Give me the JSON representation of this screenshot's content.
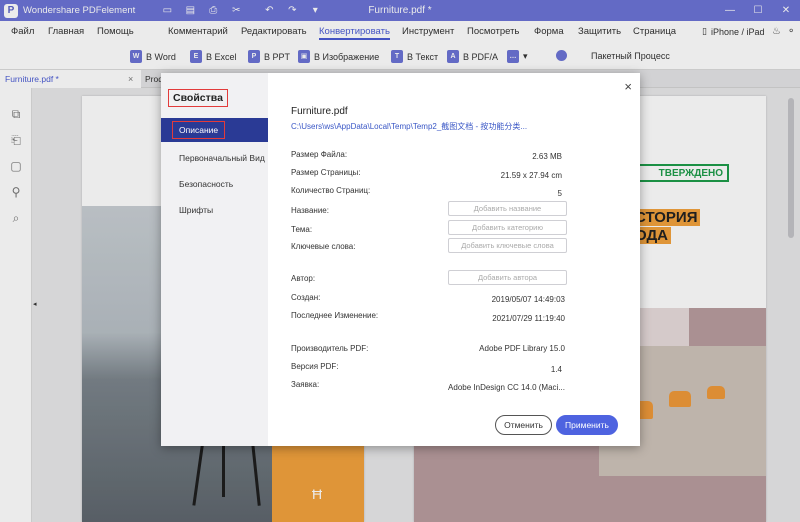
{
  "app": {
    "name": "Wondershare PDFelement",
    "document_title": "Furniture.pdf *",
    "logo_letter": "P"
  },
  "quick_access": [
    "folder-icon",
    "save-icon",
    "print-icon",
    "share-icon",
    "undo-icon",
    "redo-icon",
    "dropdown-icon"
  ],
  "window_controls": [
    "minimize-icon",
    "maximize-icon",
    "close-icon"
  ],
  "menu": {
    "items": [
      "Файл",
      "Главная",
      "Помощь",
      "Комментарий",
      "Редактировать",
      "Конвертировать",
      "Инструмент",
      "Посмотреть",
      "Форма",
      "Защитить",
      "Страница"
    ],
    "active": "Конвертировать",
    "device": "iPhone / iPad"
  },
  "toolbar": {
    "items": [
      "В Word",
      "В Excel",
      "В PPT",
      "В Изображение",
      "В Текст",
      "В PDF/A",
      "Пакетный Процесс"
    ],
    "icon_letters": [
      "W",
      "E",
      "P",
      "▣",
      "T",
      "A",
      "⬡"
    ]
  },
  "tabs": [
    {
      "label": "Furniture.pdf *",
      "close": "×"
    },
    {
      "label": "Prod"
    }
  ],
  "page_preview": {
    "stamp": "ТВЕРЖДЕНО",
    "title_lines": [
      "СТОРИЯ",
      "ОДА"
    ],
    "chair_glyph": "Ħ"
  },
  "dialog": {
    "title": "Свойства",
    "close": "×",
    "nav": [
      "Описание",
      "Первоначальный Вид",
      "Безопасность",
      "Шрифты"
    ],
    "nav_active": "Описание",
    "file_name": "Furniture.pdf",
    "file_path": "C:\\Users\\ws\\AppData\\Local\\Temp\\Temp2_截图文档 - 按功能分类...",
    "props": {
      "file_size": {
        "label": "Размер Файла:",
        "value": "2.63 MB"
      },
      "page_size": {
        "label": "Размер Страницы:",
        "value": "21.59 x 27.94 cm"
      },
      "page_count": {
        "label": "Количество Страниц:",
        "value": "5"
      },
      "title": {
        "label": "Название:",
        "placeholder": "Добавить название"
      },
      "subject": {
        "label": "Тема:",
        "placeholder": "Добавить категорию"
      },
      "keywords": {
        "label": "Ключевые слова:",
        "placeholder": "Добавить ключевые слова"
      },
      "author": {
        "label": "Автор:",
        "placeholder": "Добавить автора"
      },
      "created": {
        "label": "Создан:",
        "value": "2019/05/07 14:49:03"
      },
      "modified": {
        "label": "Последнее Изменение:",
        "value": "2021/07/29 11:19:40"
      },
      "producer": {
        "label": "Производитель PDF:",
        "value": "Adobe PDF Library 15.0"
      },
      "version": {
        "label": "Версия PDF:",
        "value": "1.4"
      },
      "creator": {
        "label": "Заявка:",
        "value": "Adobe InDesign CC 14.0 (Maci..."
      }
    },
    "buttons": {
      "cancel": "Отменить",
      "apply": "Применить"
    }
  }
}
